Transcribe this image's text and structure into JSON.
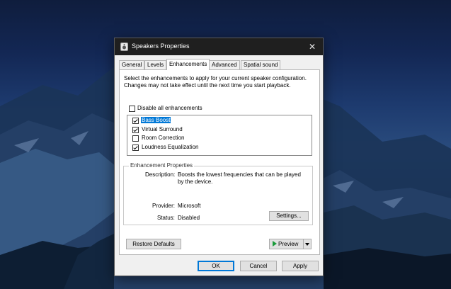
{
  "window": {
    "title": "Speakers Properties",
    "close_glyph": "✕"
  },
  "tabs": [
    "General",
    "Levels",
    "Enhancements",
    "Advanced",
    "Spatial sound"
  ],
  "active_tab": "Enhancements",
  "instructions": "Select the enhancements to apply for your current speaker configuration. Changes may not take effect until the next time you start playback.",
  "disable_all": {
    "label": "Disable all enhancements",
    "checked": false
  },
  "enhancements": [
    {
      "label": "Bass Boost",
      "checked": true,
      "selected": true
    },
    {
      "label": "Virtual Surround",
      "checked": true,
      "selected": false
    },
    {
      "label": "Room Correction",
      "checked": false,
      "selected": false
    },
    {
      "label": "Loudness Equalization",
      "checked": true,
      "selected": false
    }
  ],
  "properties": {
    "group_title": "Enhancement Properties",
    "description_label": "Description:",
    "description_value": "Boosts the lowest frequencies that can be played by the device.",
    "provider_label": "Provider:",
    "provider_value": "Microsoft",
    "status_label": "Status:",
    "status_value": "Disabled",
    "settings_button": "Settings..."
  },
  "buttons": {
    "restore_defaults": "Restore Defaults",
    "preview": "Preview",
    "ok": "OK",
    "cancel": "Cancel",
    "apply": "Apply"
  },
  "colors": {
    "titlebar": "#1f1f1f",
    "selection": "#0078d7",
    "preview_play": "#1a9b3a"
  }
}
